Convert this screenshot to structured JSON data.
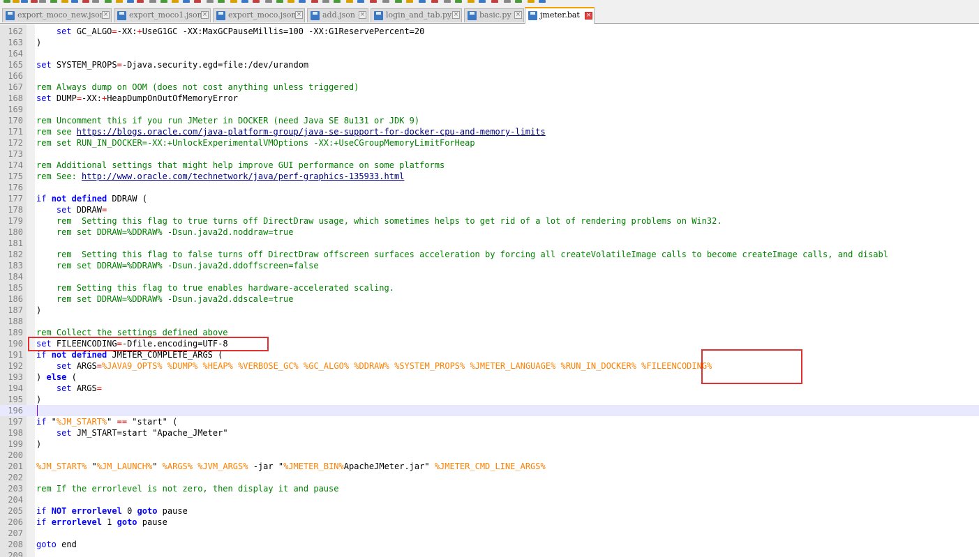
{
  "tabs": [
    {
      "label": "export_moco_new.json",
      "active": false
    },
    {
      "label": "export_moco1.json",
      "active": false
    },
    {
      "label": "export_moco.json",
      "active": false
    },
    {
      "label": "add.json",
      "active": false
    },
    {
      "label": "login_and_tab.py",
      "active": false
    },
    {
      "label": "basic.py",
      "active": false
    },
    {
      "label": "jmeter.bat",
      "active": true
    }
  ],
  "tab_close_glyph": "×",
  "icons": {
    "tab_file": "floppy-disk-icon",
    "tab_close": "close-icon"
  },
  "colors": {
    "keyword": "#0000ff",
    "variable": "#ff8000",
    "comment": "#008000",
    "operator": "#ff0000",
    "string": "#808080",
    "url": "#000080",
    "highlight_box": "#e03030",
    "current_line": "#e8e8ff",
    "active_tab_accent": "#f5a000"
  },
  "editor": {
    "current_line": 196,
    "lines": [
      {
        "n": 162,
        "t": [
          [
            "",
            "    "
          ],
          [
            "kw",
            "set"
          ],
          [
            "",
            " GC_ALGO"
          ],
          [
            "op",
            "="
          ],
          [
            "",
            "-XX:"
          ],
          [
            "op",
            "+"
          ],
          [
            "",
            "UseG1GC -XX:MaxGCPauseMillis=100 -XX:G1ReservePercent=20"
          ]
        ]
      },
      {
        "n": 163,
        "t": [
          [
            "",
            ")"
          ]
        ]
      },
      {
        "n": 164,
        "t": []
      },
      {
        "n": 165,
        "t": [
          [
            "kw",
            "set"
          ],
          [
            "",
            " SYSTEM_PROPS"
          ],
          [
            "op",
            "="
          ],
          [
            "",
            "-Djava.security.egd=file:/dev/urandom"
          ]
        ]
      },
      {
        "n": 166,
        "t": []
      },
      {
        "n": 167,
        "t": [
          [
            "com",
            "rem Always dump on OOM (does not cost anything unless triggered)"
          ]
        ]
      },
      {
        "n": 168,
        "t": [
          [
            "kw",
            "set"
          ],
          [
            "",
            " DUMP"
          ],
          [
            "op",
            "="
          ],
          [
            "",
            "-XX:"
          ],
          [
            "op",
            "+"
          ],
          [
            "",
            "HeapDumpOnOutOfMemoryError"
          ]
        ]
      },
      {
        "n": 169,
        "t": []
      },
      {
        "n": 170,
        "t": [
          [
            "com",
            "rem Uncomment this if you run JMeter in DOCKER (need Java SE 8u131 or JDK 9)"
          ]
        ]
      },
      {
        "n": 171,
        "t": [
          [
            "com",
            "rem see "
          ],
          [
            "url",
            "https://blogs.oracle.com/java-platform-group/java-se-support-for-docker-cpu-and-memory-limits"
          ]
        ]
      },
      {
        "n": 172,
        "t": [
          [
            "com",
            "rem set RUN_IN_DOCKER=-XX:+UnlockExperimentalVMOptions -XX:+UseCGroupMemoryLimitForHeap"
          ]
        ]
      },
      {
        "n": 173,
        "t": []
      },
      {
        "n": 174,
        "t": [
          [
            "com",
            "rem Additional settings that might help improve GUI performance on some platforms"
          ]
        ]
      },
      {
        "n": 175,
        "t": [
          [
            "com",
            "rem See: "
          ],
          [
            "url",
            "http://www.oracle.com/technetwork/java/perf-graphics-135933.html"
          ]
        ]
      },
      {
        "n": 176,
        "t": []
      },
      {
        "n": 177,
        "t": [
          [
            "kw",
            "if"
          ],
          [
            "",
            " "
          ],
          [
            "kw b",
            "not"
          ],
          [
            "",
            " "
          ],
          [
            "kw b",
            "defined"
          ],
          [
            "",
            " DDRAW ("
          ]
        ]
      },
      {
        "n": 178,
        "t": [
          [
            "",
            "    "
          ],
          [
            "kw",
            "set"
          ],
          [
            "",
            " DDRAW"
          ],
          [
            "op",
            "="
          ]
        ]
      },
      {
        "n": 179,
        "t": [
          [
            "",
            "    "
          ],
          [
            "com",
            "rem  Setting this flag to true turns off DirectDraw usage, which sometimes helps to get rid of a lot of rendering problems on Win32."
          ]
        ]
      },
      {
        "n": 180,
        "t": [
          [
            "",
            "    "
          ],
          [
            "com",
            "rem set DDRAW=%DDRAW% -Dsun.java2d.noddraw=true"
          ]
        ]
      },
      {
        "n": 181,
        "t": []
      },
      {
        "n": 182,
        "t": [
          [
            "",
            "    "
          ],
          [
            "com",
            "rem  Setting this flag to false turns off DirectDraw offscreen surfaces acceleration by forcing all createVolatileImage calls to become createImage calls, and disabl"
          ]
        ]
      },
      {
        "n": 183,
        "t": [
          [
            "",
            "    "
          ],
          [
            "com",
            "rem set DDRAW=%DDRAW% -Dsun.java2d.ddoffscreen=false"
          ]
        ]
      },
      {
        "n": 184,
        "t": []
      },
      {
        "n": 185,
        "t": [
          [
            "",
            "    "
          ],
          [
            "com",
            "rem Setting this flag to true enables hardware-accelerated scaling."
          ]
        ]
      },
      {
        "n": 186,
        "t": [
          [
            "",
            "    "
          ],
          [
            "com",
            "rem set DDRAW=%DDRAW% -Dsun.java2d.ddscale=true"
          ]
        ]
      },
      {
        "n": 187,
        "t": [
          [
            "",
            ")"
          ]
        ]
      },
      {
        "n": 188,
        "t": []
      },
      {
        "n": 189,
        "t": [
          [
            "com",
            "rem Collect the settings defined above"
          ]
        ]
      },
      {
        "n": 190,
        "t": [
          [
            "kw",
            "set"
          ],
          [
            "",
            " FILEENCODING"
          ],
          [
            "op",
            "="
          ],
          [
            "",
            "-Dfile.encoding=UTF-8"
          ]
        ]
      },
      {
        "n": 191,
        "t": [
          [
            "kw",
            "if"
          ],
          [
            "",
            " "
          ],
          [
            "kw b",
            "not"
          ],
          [
            "",
            " "
          ],
          [
            "kw b",
            "defined"
          ],
          [
            "",
            " JMETER_COMPLETE_ARGS ("
          ]
        ]
      },
      {
        "n": 192,
        "t": [
          [
            "",
            "    "
          ],
          [
            "kw",
            "set"
          ],
          [
            "",
            " ARGS"
          ],
          [
            "op",
            "="
          ],
          [
            "var",
            "%JAVA9_OPTS%"
          ],
          [
            "",
            " "
          ],
          [
            "var",
            "%DUMP%"
          ],
          [
            "",
            " "
          ],
          [
            "var",
            "%HEAP%"
          ],
          [
            "",
            " "
          ],
          [
            "var",
            "%VERBOSE_GC%"
          ],
          [
            "",
            " "
          ],
          [
            "var",
            "%GC_ALGO%"
          ],
          [
            "",
            " "
          ],
          [
            "var",
            "%DDRAW%"
          ],
          [
            "",
            " "
          ],
          [
            "var",
            "%SYSTEM_PROPS%"
          ],
          [
            "",
            " "
          ],
          [
            "var",
            "%JMETER_LANGUAGE%"
          ],
          [
            "",
            " "
          ],
          [
            "var",
            "%RUN_IN_DOCKER%"
          ],
          [
            "",
            " "
          ],
          [
            "var",
            "%FILEENCODING%"
          ]
        ]
      },
      {
        "n": 193,
        "t": [
          [
            "",
            ") "
          ],
          [
            "kw b",
            "else"
          ],
          [
            "",
            " ("
          ]
        ]
      },
      {
        "n": 194,
        "t": [
          [
            "",
            "    "
          ],
          [
            "kw",
            "set"
          ],
          [
            "",
            " ARGS"
          ],
          [
            "op",
            "="
          ]
        ]
      },
      {
        "n": 195,
        "t": [
          [
            "",
            ")"
          ]
        ]
      },
      {
        "n": 196,
        "t": []
      },
      {
        "n": 197,
        "t": [
          [
            "kw",
            "if"
          ],
          [
            "",
            " \""
          ],
          [
            "var",
            "%JM_START%"
          ],
          [
            "",
            "\" "
          ],
          [
            "op",
            "=="
          ],
          [
            "",
            " \"start\" ("
          ]
        ]
      },
      {
        "n": 198,
        "t": [
          [
            "",
            "    "
          ],
          [
            "kw",
            "set"
          ],
          [
            "",
            " JM_START=start \"Apache_JMeter\""
          ]
        ]
      },
      {
        "n": 199,
        "t": [
          [
            "",
            ")"
          ]
        ]
      },
      {
        "n": 200,
        "t": []
      },
      {
        "n": 201,
        "t": [
          [
            "var",
            "%JM_START%"
          ],
          [
            "",
            " \""
          ],
          [
            "var",
            "%JM_LAUNCH%"
          ],
          [
            "",
            "\" "
          ],
          [
            "var",
            "%ARGS%"
          ],
          [
            "",
            " "
          ],
          [
            "var",
            "%JVM_ARGS%"
          ],
          [
            "",
            " -jar \""
          ],
          [
            "var",
            "%JMETER_BIN%"
          ],
          [
            "",
            "ApacheJMeter.jar\" "
          ],
          [
            "var",
            "%JMETER_CMD_LINE_ARGS%"
          ]
        ]
      },
      {
        "n": 202,
        "t": []
      },
      {
        "n": 203,
        "t": [
          [
            "com",
            "rem If the errorlevel is not zero, then display it and pause"
          ]
        ]
      },
      {
        "n": 204,
        "t": []
      },
      {
        "n": 205,
        "t": [
          [
            "kw",
            "if"
          ],
          [
            "",
            " "
          ],
          [
            "kw b",
            "NOT"
          ],
          [
            "",
            " "
          ],
          [
            "kw b",
            "errorlevel"
          ],
          [
            "",
            " 0 "
          ],
          [
            "kw b",
            "goto"
          ],
          [
            "",
            " pause"
          ]
        ]
      },
      {
        "n": 206,
        "t": [
          [
            "kw",
            "if"
          ],
          [
            "",
            " "
          ],
          [
            "kw b",
            "errorlevel"
          ],
          [
            "",
            " 1 "
          ],
          [
            "kw b",
            "goto"
          ],
          [
            "",
            " pause"
          ]
        ]
      },
      {
        "n": 207,
        "t": []
      },
      {
        "n": 208,
        "t": [
          [
            "kw",
            "goto"
          ],
          [
            "",
            " end"
          ]
        ]
      },
      {
        "n": 209,
        "t": []
      }
    ]
  }
}
